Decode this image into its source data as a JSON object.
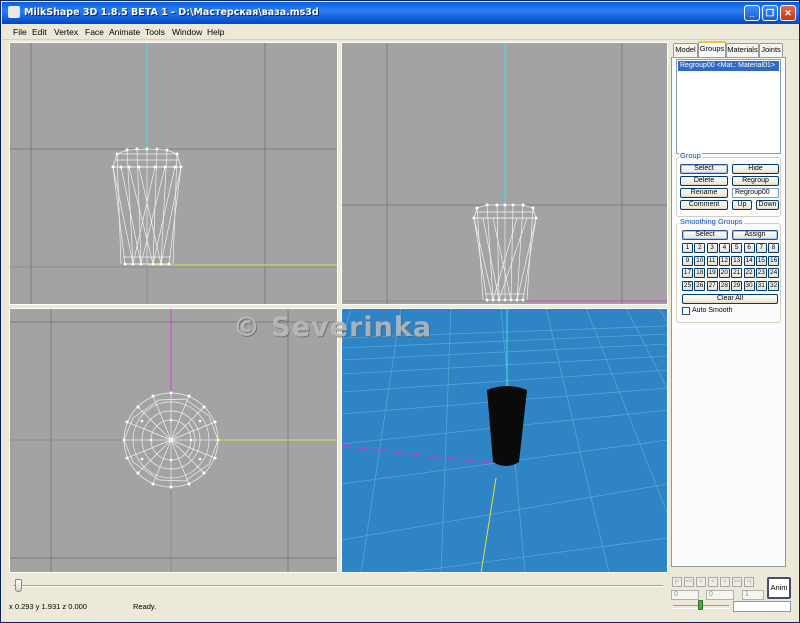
{
  "window": {
    "title": "MilkShape 3D 1.8.5 BETA 1 - D:\\Мастерская\\ваза.ms3d",
    "minimize_label": "_",
    "maximize_label": "❐",
    "close_label": "✕"
  },
  "menu": [
    "File",
    "Edit",
    "Vertex",
    "Face",
    "Animate",
    "Tools",
    "Window",
    "Help"
  ],
  "watermark": "© Severinka",
  "panel": {
    "tabs": [
      "Model",
      "Groups",
      "Materials",
      "Joints"
    ],
    "active_tab": "Groups",
    "group_list_items": [
      "Regroup00 <Mat.: Material01>"
    ],
    "group_section": {
      "legend": "Group",
      "select_label": "Select",
      "hide_label": "Hide",
      "delete_label": "Delete",
      "regroup_label": "Regroup",
      "rename_label": "Rename",
      "name_value": "Regroup00",
      "comment_label": "Comment",
      "up_label": "Up",
      "down_label": "Down"
    },
    "smoothing_section": {
      "legend": "Smoothing Groups",
      "select_label": "Select",
      "assign_label": "Assign",
      "numbers": [
        "1",
        "2",
        "3",
        "4",
        "5",
        "6",
        "7",
        "8",
        "9",
        "10",
        "11",
        "12",
        "13",
        "14",
        "15",
        "16",
        "17",
        "18",
        "19",
        "20",
        "21",
        "22",
        "23",
        "24",
        "25",
        "26",
        "27",
        "28",
        "29",
        "30",
        "31",
        "32"
      ],
      "clear_all_label": "Clear All",
      "auto_smooth_label": "Auto Smooth",
      "auto_smooth_checked": false
    }
  },
  "timeline": {
    "current_frame_fraction": 0.0,
    "nav_buttons": [
      "|<",
      "<<",
      "<",
      "<",
      ">",
      ">>",
      ">|"
    ],
    "frame_current": "0",
    "frame_start": "0",
    "frame_end": "1",
    "anim_label": "Anim"
  },
  "status": {
    "coords": "x 0.293 y 1.931 z 0.000",
    "message": "Ready."
  },
  "colors": {
    "viewport_bg": "#a3a3a3",
    "perspective_bg": "#2e84c4",
    "axis_y": "#40e0e0",
    "axis_x": "#e0e040",
    "axis_z": "#d040d0",
    "mesh": "#ffffff"
  },
  "icons": [
    "milkshape-app-icon",
    "minimize-icon",
    "maximize-icon",
    "close-icon"
  ]
}
